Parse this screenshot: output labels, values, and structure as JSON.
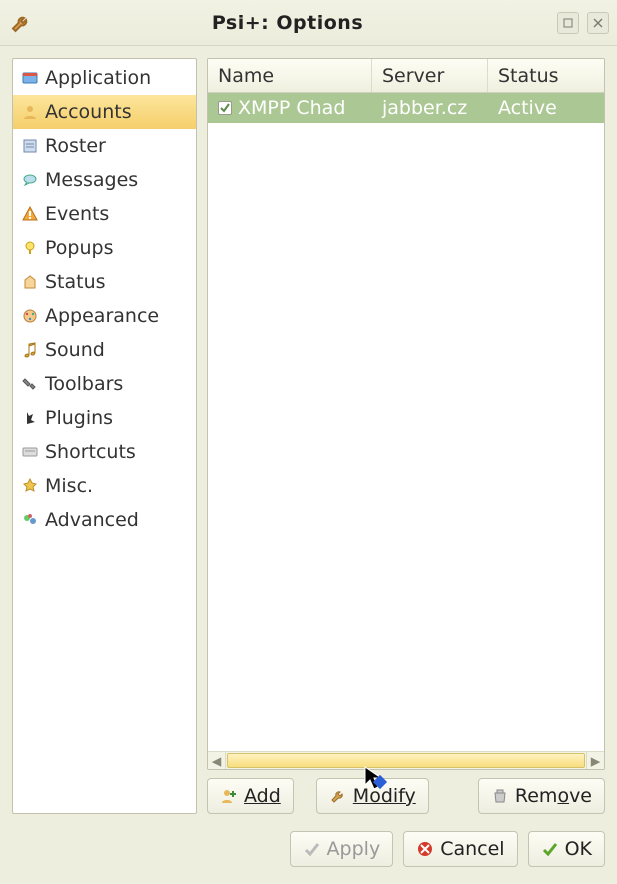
{
  "window": {
    "title": "Psi+: Options"
  },
  "sidebar": {
    "items": [
      {
        "label": "Application"
      },
      {
        "label": "Accounts"
      },
      {
        "label": "Roster"
      },
      {
        "label": "Messages"
      },
      {
        "label": "Events"
      },
      {
        "label": "Popups"
      },
      {
        "label": "Status"
      },
      {
        "label": "Appearance"
      },
      {
        "label": "Sound"
      },
      {
        "label": "Toolbars"
      },
      {
        "label": "Plugins"
      },
      {
        "label": "Shortcuts"
      },
      {
        "label": "Misc."
      },
      {
        "label": "Advanced"
      }
    ],
    "selected_index": 1
  },
  "accounts": {
    "headers": {
      "name": "Name",
      "server": "Server",
      "status": "Status"
    },
    "rows": [
      {
        "checked": true,
        "name": "XMPP Chad",
        "server": "jabber.cz",
        "status": "Active"
      }
    ],
    "selected_index": 0,
    "buttons": {
      "add": "Add",
      "modify": "Modify",
      "remove": "Remove"
    }
  },
  "footer": {
    "apply": "Apply",
    "cancel": "Cancel",
    "ok": "OK"
  }
}
